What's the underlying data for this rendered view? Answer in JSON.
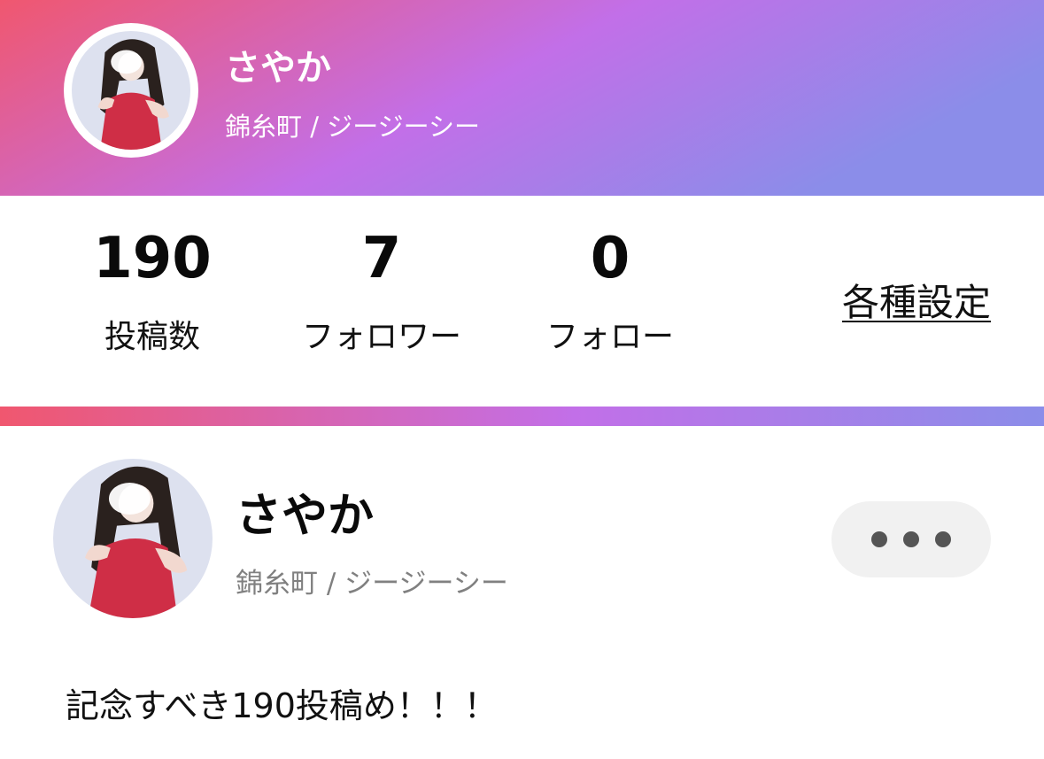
{
  "colors": {
    "gradient_start": "#f0576f",
    "gradient_mid": "#c26fe8",
    "gradient_end": "#8b8de9",
    "more_button_bg": "#f1f1f1"
  },
  "profile": {
    "name": "さやか",
    "location": "錦糸町 / ジージーシー",
    "avatar_icon": "profile-photo"
  },
  "stats": {
    "posts": {
      "value": "190",
      "label": "投稿数"
    },
    "followers": {
      "value": "7",
      "label": "フォロワー"
    },
    "following": {
      "value": "0",
      "label": "フォロー"
    },
    "settings_label": "各種設定"
  },
  "post": {
    "author_name": "さやか",
    "author_location": "錦糸町 / ジージーシー",
    "more_icon": "more-dots-icon",
    "text": "記念すべき190投稿め！！！"
  }
}
